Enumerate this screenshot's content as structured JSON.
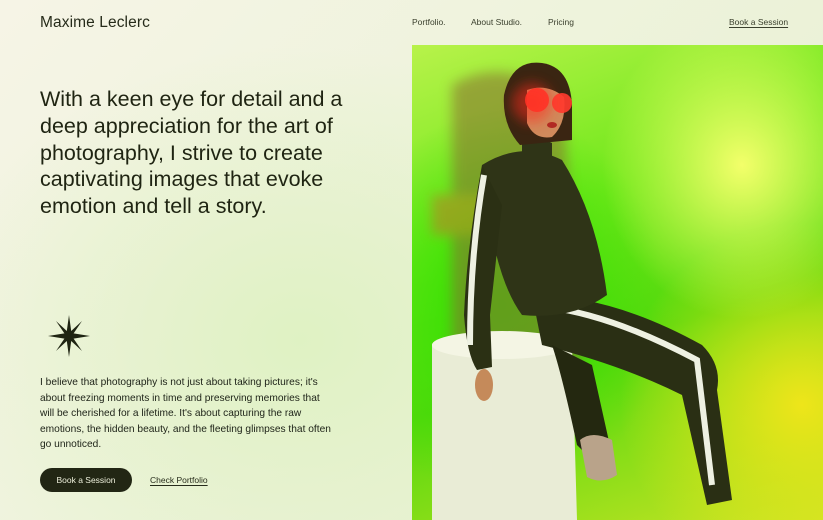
{
  "header": {
    "brand": "Maxime Leclerc",
    "nav": {
      "portfolio": "Portfolio.",
      "about": "About Studio.",
      "pricing": "Pricing",
      "book": "Book a Session"
    }
  },
  "hero": {
    "headline": "With a keen eye for detail and a deep appreciation for the art of photography, I strive to create captivating images that evoke emotion and tell a story.",
    "body": "I believe that photography is not just about taking pictures; it's about freezing moments in time and preserving memories that will be cherished for a lifetime. It's about capturing the raw emotions, the hidden beauty, and the fleeting glimpses that often go unnoticed.",
    "primary_button": "Book a Session",
    "secondary_link": "Check Portfolio"
  },
  "colors": {
    "ink": "#1f2412",
    "button_bg": "#222614",
    "photo_green": "#55d80d",
    "photo_yellow": "#eee51a"
  },
  "icons": {
    "decoration": "sparkle-star-icon"
  }
}
